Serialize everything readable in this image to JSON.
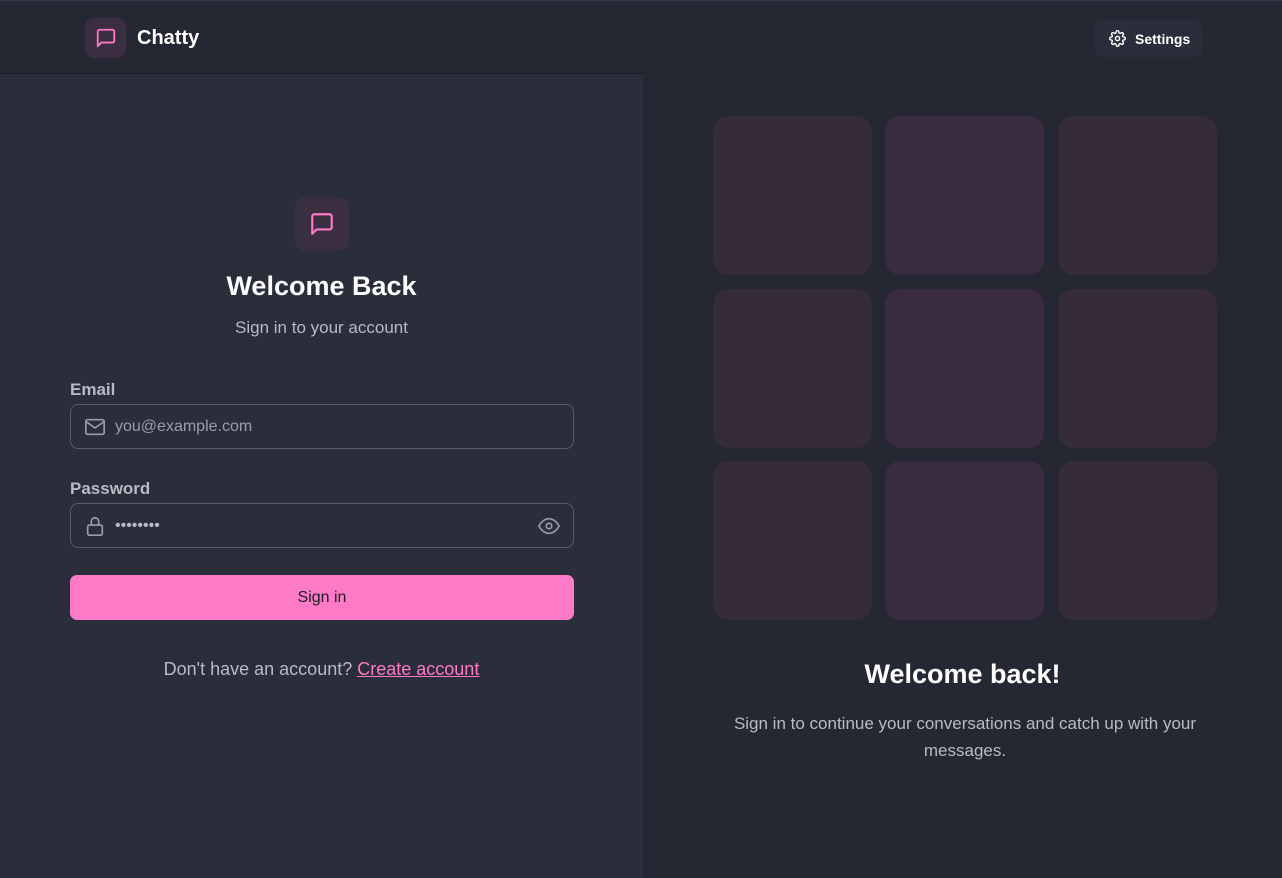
{
  "header": {
    "brand": "Chatty",
    "settings_label": "Settings"
  },
  "login": {
    "title": "Welcome Back",
    "subtitle": "Sign in to your account",
    "email_label": "Email",
    "email_placeholder": "you@example.com",
    "email_value": "",
    "password_label": "Password",
    "password_value": "••••••••",
    "signin_label": "Sign in",
    "no_account_text": "Don't have an account?",
    "create_account_label": "Create account"
  },
  "promo": {
    "title": "Welcome back!",
    "text": "Sign in to continue your conversations and catch up with your messages."
  },
  "colors": {
    "accent": "#ff7ac6",
    "background": "#2a2d3a",
    "panel": "#252833",
    "tile": "#362b3b"
  },
  "icons": [
    "message-square-icon",
    "gear-icon",
    "mail-icon",
    "lock-icon",
    "eye-icon"
  ]
}
